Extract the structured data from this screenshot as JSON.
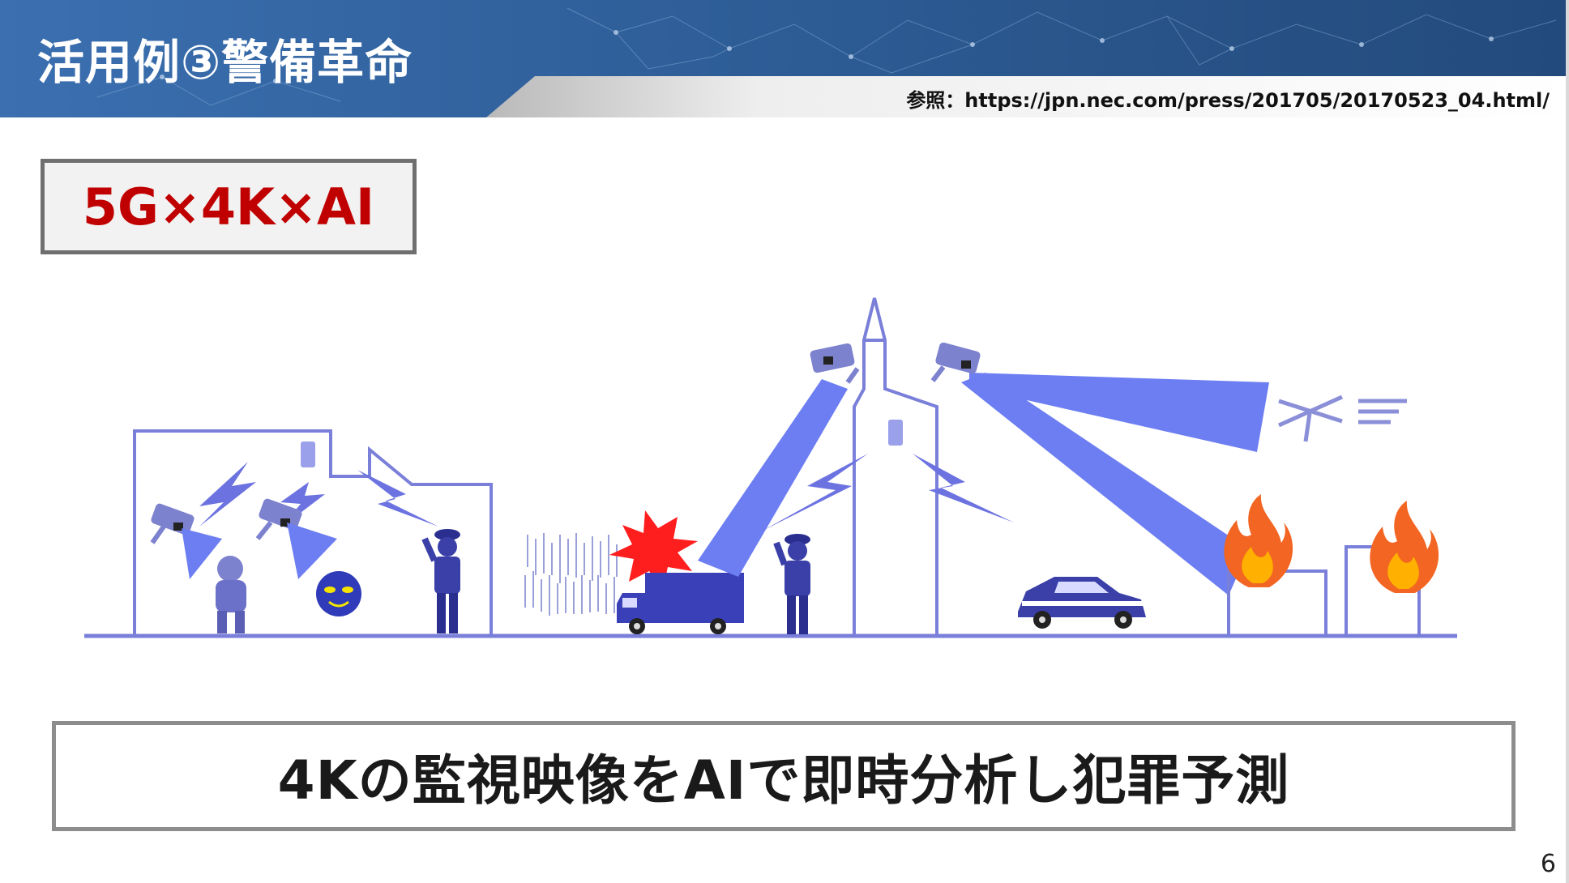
{
  "header": {
    "title": "活用例③警備革命",
    "reference": "参照：https://jpn.nec.com/press/201705/20170523_04.html/"
  },
  "tag": {
    "label": "5G×4K×AI"
  },
  "illustration": {
    "items": [
      "surveillance-camera",
      "security-guard",
      "suspicious-person",
      "masked-thief",
      "truck",
      "crowd",
      "explosion",
      "tower",
      "drone",
      "police-car",
      "fire"
    ]
  },
  "caption": {
    "text": "4Kの監視映像をAIで即時分析し犯罪予測"
  },
  "page": {
    "number": "6"
  },
  "colors": {
    "header_blue": "#2f5f9a",
    "accent_red": "#c00000",
    "illustration_blue": "#5d63d6",
    "beam_blue": "#6f7ff0",
    "fire_orange": "#f26522"
  }
}
